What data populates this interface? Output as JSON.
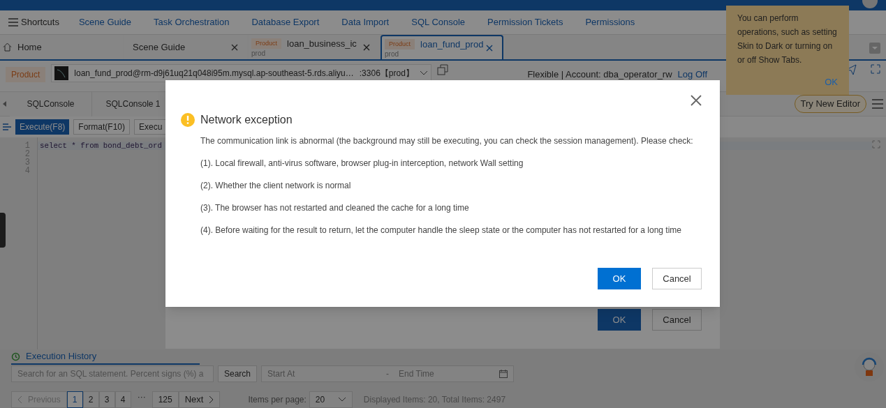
{
  "nav": {
    "shortcuts": "Shortcuts",
    "links": [
      "Scene Guide",
      "Task Orchestration",
      "Database Export",
      "Data Import",
      "SQL Console",
      "Permission Tickets",
      "Permissions"
    ]
  },
  "tabs": [
    {
      "kind": "home",
      "label": "Home",
      "selected": false
    },
    {
      "kind": "plain",
      "label": "Scene Guide",
      "selected": false
    },
    {
      "kind": "db",
      "badge": "Product",
      "label": "loan_business_ic",
      "env": "prod",
      "selected": false
    },
    {
      "kind": "db",
      "badge": "Product",
      "label": "loan_fund_prod",
      "env": "prod",
      "selected": true
    }
  ],
  "connection": {
    "badge": "Product",
    "text": "loan_fund_prod@rm-d9j61uq21q048i95m.mysql.ap-southeast-5.rds.aliyu…",
    "port": ":3306【prod】",
    "account": "Flexible | Account: dba_operator_rw",
    "logoff": "Log Off"
  },
  "console_tabs": [
    {
      "label": "SQLConsole"
    },
    {
      "label": "SQLConsole 1"
    }
  ],
  "try_new_editor": "Try New Editor",
  "toolbar": [
    {
      "kind": "primary",
      "label": "Execute(F8)"
    },
    {
      "kind": "default",
      "label": "Format(F10)"
    },
    {
      "kind": "default",
      "label": "Execu"
    }
  ],
  "editor": {
    "line_numbers": [
      "1",
      "2",
      "3",
      "4"
    ],
    "code": "select * from bond_debt_ord"
  },
  "history": {
    "tab": "Execution History",
    "search_placeholder": "Search for an SQL statement. Percent signs (%) a",
    "search_button": "Search",
    "start_placeholder": "Start At",
    "separator": "-",
    "end_placeholder": "End Time"
  },
  "pagination": {
    "previous": "Previous",
    "pages": [
      {
        "label": "1",
        "selected": true
      },
      {
        "label": "2",
        "selected": false
      },
      {
        "label": "3",
        "selected": false
      },
      {
        "label": "4",
        "selected": false
      }
    ],
    "ellipsis": "···",
    "last": "125",
    "next": "Next",
    "per_page_label": "Items per page:",
    "per_page": "20",
    "summary": "Displayed Items: 20, Total Items: 2497"
  },
  "back_dialog": {
    "ok": "OK",
    "cancel": "Cancel"
  },
  "dialog": {
    "title": "Network exception",
    "lines": [
      "The communication link is abnormal (the background may still be executing, you can check the session management). Please check:",
      "(1). Local firewall, anti-virus software, browser plug-in interception, network Wall setting",
      "(2). Whether the client network is normal",
      "(3). The browser has not restarted and cleaned the cache for a long time",
      "(4). Before waiting for the result to return, let the computer handle the sleep state or the computer has not restarted for a long time"
    ],
    "ok": "OK",
    "cancel": "Cancel"
  },
  "tooltip": {
    "text": "You can perform operations, such as setting Skin to Dark or turning on or off Show Tabs.",
    "ok": "OK"
  }
}
